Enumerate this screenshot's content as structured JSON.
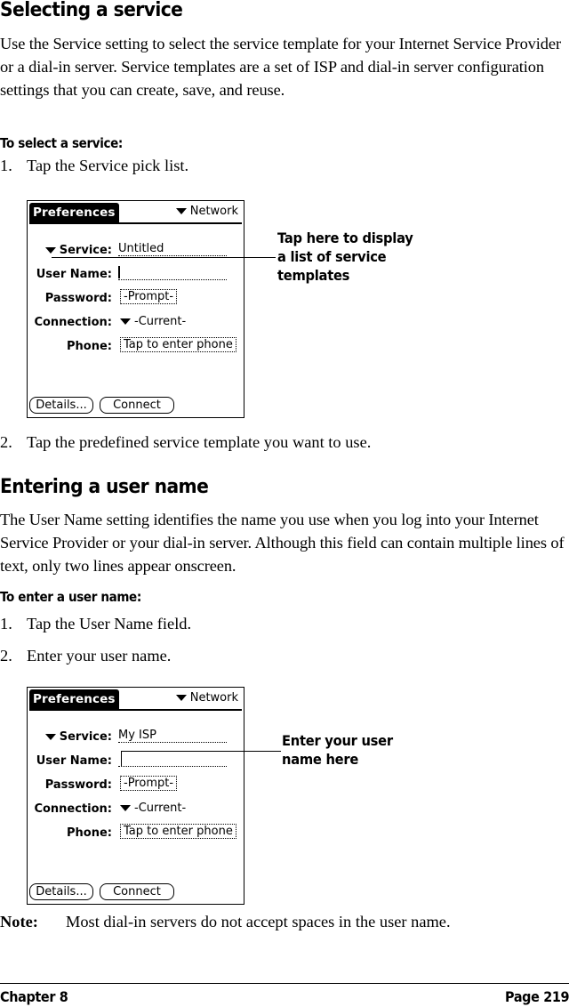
{
  "section1": {
    "heading": "Selecting a service",
    "paragraph": "Use the Service setting to select the service template for your Internet Service Provider or a dial-in server. Service templates are a set of ISP and dial-in server configuration settings that you can create, save, and reuse.",
    "procedure_title": "To select a service:",
    "steps": [
      {
        "num": "1.",
        "text": "Tap the Service pick list."
      },
      {
        "num": "2.",
        "text": "Tap the predefined service template you want to use."
      }
    ],
    "callout": [
      "Tap here to display",
      "a list of service",
      "templates"
    ],
    "screen": {
      "title": "Preferences",
      "category": "Network",
      "service_label": "Service:",
      "service_value": "Untitled",
      "username_label": "User Name:",
      "username_value": "",
      "password_label": "Password:",
      "password_value": "-Prompt-",
      "connection_label": "Connection:",
      "connection_value": "-Current-",
      "phone_label": "Phone:",
      "phone_value": "Tap to enter phone",
      "details_button": "Details...",
      "connect_button": "Connect"
    }
  },
  "section2": {
    "heading": "Entering a user name",
    "paragraph": "The User Name setting identifies the name you use when you log into your Internet Service Provider or your dial-in server. Although this field can contain multiple lines of text, only two lines appear onscreen.",
    "procedure_title": "To enter a user name:",
    "steps": [
      {
        "num": "1.",
        "text": "Tap the User Name field."
      },
      {
        "num": "2.",
        "text": "Enter your user name."
      }
    ],
    "callout": [
      "Enter your user",
      "name here"
    ],
    "screen": {
      "title": "Preferences",
      "category": "Network",
      "service_label": "Service:",
      "service_value": "My ISP",
      "username_label": "User Name:",
      "username_value": "",
      "password_label": "Password:",
      "password_value": "-Prompt-",
      "connection_label": "Connection:",
      "connection_value": "-Current-",
      "phone_label": "Phone:",
      "phone_value": "Tap to enter phone",
      "details_button": "Details...",
      "connect_button": "Connect"
    }
  },
  "note": {
    "label": "Note:",
    "text": "Most dial-in servers do not accept spaces in the user name."
  },
  "footer": {
    "chapter": "Chapter 8",
    "page": "Page 219"
  }
}
